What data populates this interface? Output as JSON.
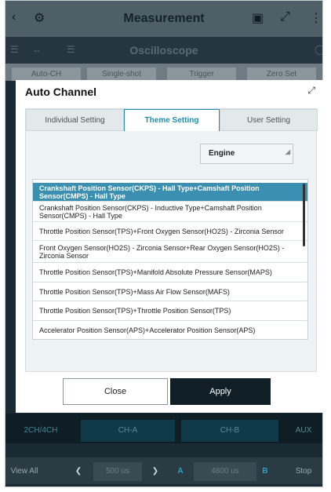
{
  "app": {
    "title": "Measurement",
    "subtitle": "Oscilloscope",
    "modes": [
      "Auto-CH",
      "Single-shot",
      "Trigger",
      "Zero Set"
    ]
  },
  "dialog": {
    "title": "Auto Channel",
    "tabs": [
      {
        "label": "Individual Setting",
        "active": false
      },
      {
        "label": "Theme Setting",
        "active": true
      },
      {
        "label": "User Setting",
        "active": false
      }
    ],
    "system_select": "Engine",
    "items": [
      "Crankshaft Position Sensor(CKPS) - Hall Type+Camshaft Position Sensor(CMPS) - Hall Type",
      "Crankshaft Position Sensor(CKPS) - Inductive Type+Camshaft Position Sensor(CMPS) - Hall Type",
      "Throttle Position Sensor(TPS)+Front Oxygen Sensor(HO2S) - Zirconia Sensor",
      "Front Oxygen Sensor(HO2S) - Zirconia Sensor+Rear Oxygen Sensor(HO2S) - Zirconia Sensor",
      "Throttle Position Sensor(TPS)+Manifold Absolute Pressure Sensor(MAPS)",
      "Throttle Position Sensor(TPS)+Mass Air Flow Sensor(MAFS)",
      "Throttle Position Sensor(TPS)+Throttle Position Sensor(TPS)",
      "Accelerator Position Sensor(APS)+Accelerator Position Sensor(APS)"
    ],
    "selected_index": 0,
    "close_label": "Close",
    "apply_label": "Apply"
  },
  "bottom": {
    "channel_mode": "2CH/4CH",
    "ch_a": "CH-A",
    "ch_b": "CH-B",
    "aux": "AUX",
    "view_all": "View All",
    "time_a": "500 us",
    "a": "A",
    "time_b": "4800 us",
    "b": "B",
    "stop": "Stop"
  },
  "colors": {
    "accent": "#1e8fb0",
    "selected_row": "#3b8fb0",
    "apply_bg": "#101e26"
  }
}
